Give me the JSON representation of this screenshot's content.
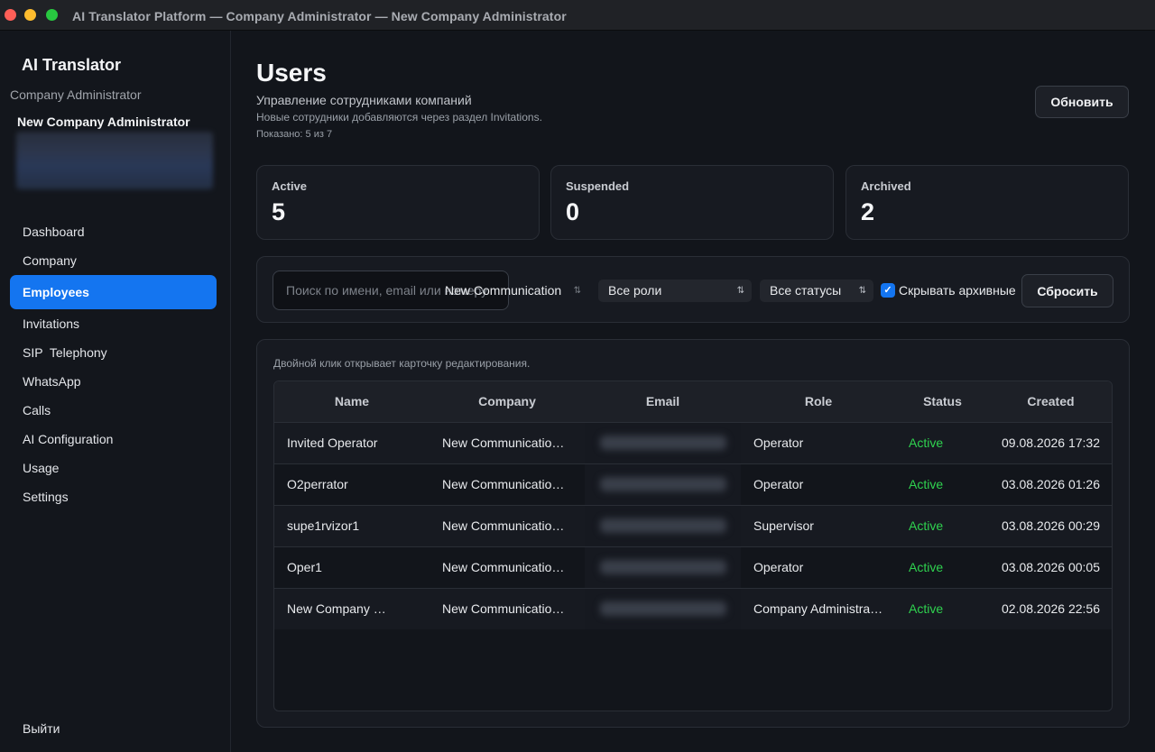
{
  "window": {
    "title": "AI Translator Platform — Company Administrator — New Company Administrator"
  },
  "sidebar": {
    "app_name": "AI Translator",
    "role": "Company Administrator",
    "user_name": "New Company Administrator",
    "items": [
      {
        "label": "Dashboard"
      },
      {
        "label": "Company"
      },
      {
        "label": "Employees",
        "active": true
      },
      {
        "label": "Invitations"
      },
      {
        "label": "SIP  Telephony"
      },
      {
        "label": "WhatsApp"
      },
      {
        "label": "Calls"
      },
      {
        "label": "AI Configuration"
      },
      {
        "label": "Usage"
      },
      {
        "label": "Settings"
      }
    ],
    "logout_label": "Выйти"
  },
  "header": {
    "title": "Users",
    "subtitle": "Управление сотрудниками компаний",
    "hint": "Новые сотрудники добавляются через раздел Invitations.",
    "shown": "Показано: 5 из 7",
    "refresh_label": "Обновить"
  },
  "stats": [
    {
      "label": "Active",
      "value": "5"
    },
    {
      "label": "Suspended",
      "value": "0"
    },
    {
      "label": "Archived",
      "value": "2"
    }
  ],
  "filters": {
    "search_placeholder": "Поиск по имени, email или номеру",
    "search_value": "",
    "company": "New Communication",
    "roles": "Все роли",
    "statuses": "Все статусы",
    "hide_archived_label": "Скрывать архивные",
    "hide_archived_checked": true,
    "reset_label": "Сбросить"
  },
  "table": {
    "hint": "Двойной клик открывает карточку редактирования.",
    "columns": [
      "Name",
      "Company",
      "Email",
      "Role",
      "Status",
      "Created"
    ],
    "rows": [
      {
        "name": "Invited Operator",
        "company": "New Communicatio…",
        "role": "Operator",
        "status": "Active",
        "created": "09.08.2026 17:32"
      },
      {
        "name": "O2perrator",
        "company": "New Communicatio…",
        "role": "Operator",
        "status": "Active",
        "created": "03.08.2026 01:26"
      },
      {
        "name": "supe1rvizor1",
        "company": "New Communicatio…",
        "role": "Supervisor",
        "status": "Active",
        "created": "03.08.2026 00:29"
      },
      {
        "name": "Oper1",
        "company": "New Communicatio…",
        "role": "Operator",
        "status": "Active",
        "created": "03.08.2026 00:05"
      },
      {
        "name": "New Company …",
        "company": "New Communicatio…",
        "role": "Company Administrator",
        "status": "Active",
        "created": "02.08.2026 22:56"
      }
    ]
  },
  "colors": {
    "accent": "#1475f0",
    "status_active": "#2fd24f"
  }
}
